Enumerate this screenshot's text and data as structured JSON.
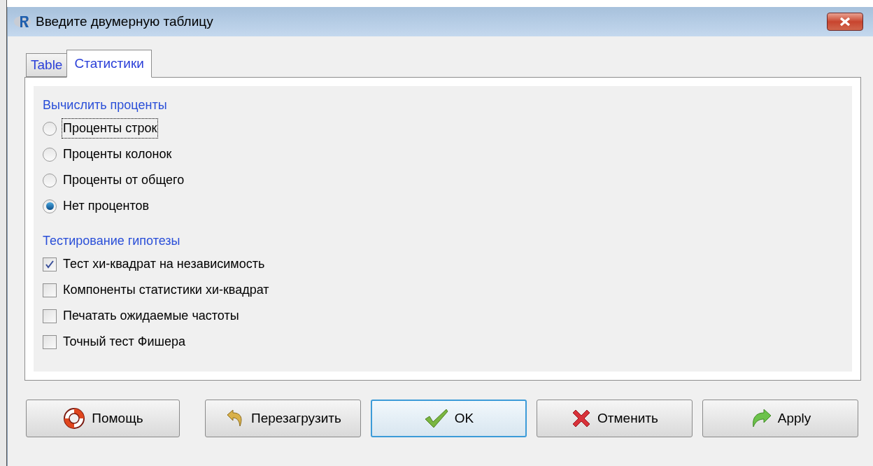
{
  "window": {
    "title": "Введите двумерную таблицу"
  },
  "tabs": [
    {
      "label": "Table",
      "selected": false
    },
    {
      "label": "Статистики",
      "selected": true
    }
  ],
  "sections": [
    {
      "heading": "Вычислить проценты",
      "options": [
        {
          "kind": "radio",
          "label": "Проценты строк",
          "selected": false,
          "focused": true
        },
        {
          "kind": "radio",
          "label": "Проценты колонок",
          "selected": false,
          "focused": false
        },
        {
          "kind": "radio",
          "label": "Проценты от общего",
          "selected": false,
          "focused": false
        },
        {
          "kind": "radio",
          "label": "Нет процентов",
          "selected": true,
          "focused": false
        }
      ]
    },
    {
      "heading": "Тестирование гипотезы",
      "options": [
        {
          "kind": "checkbox",
          "label": "Тест хи-квадрат на независимость",
          "checked": true,
          "focused": false
        },
        {
          "kind": "checkbox",
          "label": "Компоненты статистики хи-квадрат",
          "checked": false,
          "focused": false
        },
        {
          "kind": "checkbox",
          "label": "Печатать ожидаемые частоты",
          "checked": false,
          "focused": false
        },
        {
          "kind": "checkbox",
          "label": "Точный тест Фишера",
          "checked": false,
          "focused": false
        }
      ]
    }
  ],
  "buttons": [
    {
      "kind": "help",
      "label": "Помощь",
      "default": false
    },
    {
      "kind": "reset",
      "label": "Перезагрузить",
      "default": false
    },
    {
      "kind": "ok",
      "label": "OK",
      "default": true
    },
    {
      "kind": "cancel",
      "label": "Отменить",
      "default": false
    },
    {
      "kind": "apply",
      "label": "Apply",
      "default": false
    }
  ]
}
